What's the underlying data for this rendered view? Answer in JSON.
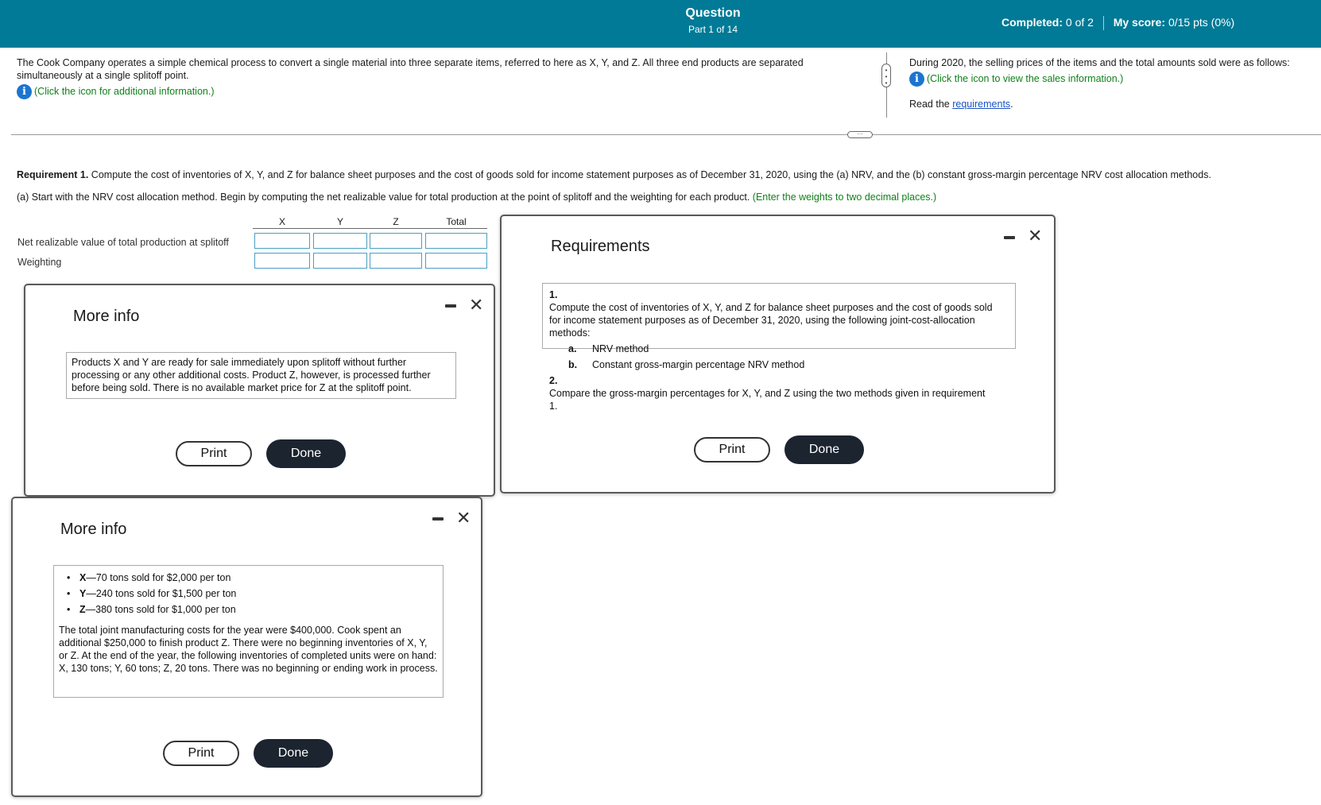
{
  "header": {
    "title": "Question",
    "subtitle": "Part 1 of 14",
    "completed_label": "Completed:",
    "completed_value": "0 of 2",
    "score_label": "My score:",
    "score_value": "0/15 pts (0%)"
  },
  "intro": {
    "text": "The Cook Company operates a simple chemical process to convert a single material into three separate items, referred to here as X, Y, and Z. All three end products are separated simultaneously at a single splitoff point.",
    "info_link": "(Click the icon for additional information.)"
  },
  "right_intro": {
    "text": "During 2020, the selling prices of the items and the total amounts sold were as follows:",
    "info_link": "(Click the icon to view the sales information.)",
    "read_prefix": "Read the",
    "read_link": "requirements",
    "read_suffix": "."
  },
  "requirement": {
    "label": "Requirement 1.",
    "text": "Compute the cost of inventories of X, Y, and Z for balance sheet purposes and the cost of goods sold for income statement purposes as of December 31, 2020, using the (a) NRV, and the (b) constant gross-margin percentage NRV cost allocation methods.",
    "part_a": "(a) Start with the NRV cost allocation method. Begin by computing the net realizable value for total production at the point of splitoff and the weighting for each product.",
    "part_a_hint": "(Enter the weights to two decimal places.)"
  },
  "table": {
    "headers": [
      "X",
      "Y",
      "Z",
      "Total"
    ],
    "rows": [
      {
        "label": "Net realizable value of total production at splitoff",
        "values": [
          "",
          "",
          "",
          ""
        ]
      },
      {
        "label": "Weighting",
        "values": [
          "",
          "",
          "",
          ""
        ]
      }
    ]
  },
  "dialog_more_info_1": {
    "title": "More info",
    "body": "Products X and Y are ready for sale immediately upon splitoff without further processing or any other additional costs. Product Z, however, is processed further before being sold. There is no available market price for Z at the splitoff point.",
    "print_label": "Print",
    "done_label": "Done"
  },
  "dialog_more_info_2": {
    "title": "More info",
    "items": [
      {
        "product": "X",
        "text": "—70 tons sold for $2,000 per ton"
      },
      {
        "product": "Y",
        "text": "—240 tons sold for $1,500 per ton"
      },
      {
        "product": "Z",
        "text": "—380 tons sold for $1,000 per ton"
      }
    ],
    "body": "The total joint manufacturing costs for the year were $400,000. Cook spent an additional $250,000 to finish product Z. There were no beginning inventories of X, Y, or Z. At the end of the year, the following inventories of completed units were on hand: X, 130 tons; Y, 60 tons; Z, 20 tons. There was no beginning or ending work in process.",
    "print_label": "Print",
    "done_label": "Done"
  },
  "dialog_requirements": {
    "title": "Requirements",
    "item1_num": "1.",
    "item1": "Compute the cost of inventories of X, Y, and Z for balance sheet purposes and the cost of goods sold for income statement purposes as of December 31, 2020, using the following joint-cost-allocation methods:",
    "sub_a_num": "a.",
    "sub_a": "NRV method",
    "sub_b_num": "b.",
    "sub_b": "Constant gross-margin percentage NRV method",
    "item2_num": "2.",
    "item2": "Compare the gross-margin percentages for X, Y, and Z using the two methods given in requirement 1.",
    "print_label": "Print",
    "done_label": "Done"
  },
  "icons": {
    "info": "info-icon",
    "minimize": "minimize-icon",
    "close": "close-icon"
  },
  "colors": {
    "header_bg": "#007a96",
    "hint_green": "#11811a",
    "info_blue": "#1b75d0",
    "input_border": "#4a9fc4",
    "done_button": "#1c2430"
  }
}
